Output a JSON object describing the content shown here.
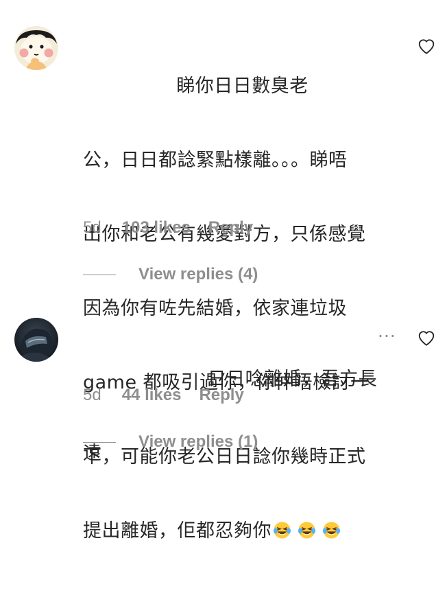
{
  "comments": [
    {
      "lines": [
        "               睇你日日數臭老",
        "公，日日都諗緊點樣離。。。睇唔",
        "出你和老公有幾愛對方，只係感覺",
        "因為你有咗先結婚，依家連垃圾",
        "game 都吸引過你，你仲唔檢討一",
        "下，可能你老公日日諗你幾時正式",
        "提出離婚，佢都忍夠你"
      ],
      "emojis": [
        "laughing-tears-emoji",
        "laughing-tears-emoji",
        "laughing-tears-emoji"
      ],
      "time": "5d",
      "likes": "103 likes",
      "reply": "Reply",
      "view_replies": "View replies (4)"
    },
    {
      "lines": [
        "                    日日唸離婚，吾方長",
        "遠"
      ],
      "more": "...",
      "time": "5d",
      "likes": "44 likes",
      "reply": "Reply",
      "view_replies": "View replies (1)"
    }
  ],
  "colors": {
    "text": "#262626",
    "secondary": "#8e8e8e",
    "background": "#ffffff"
  },
  "icons": {
    "like": "heart-outline-icon"
  }
}
